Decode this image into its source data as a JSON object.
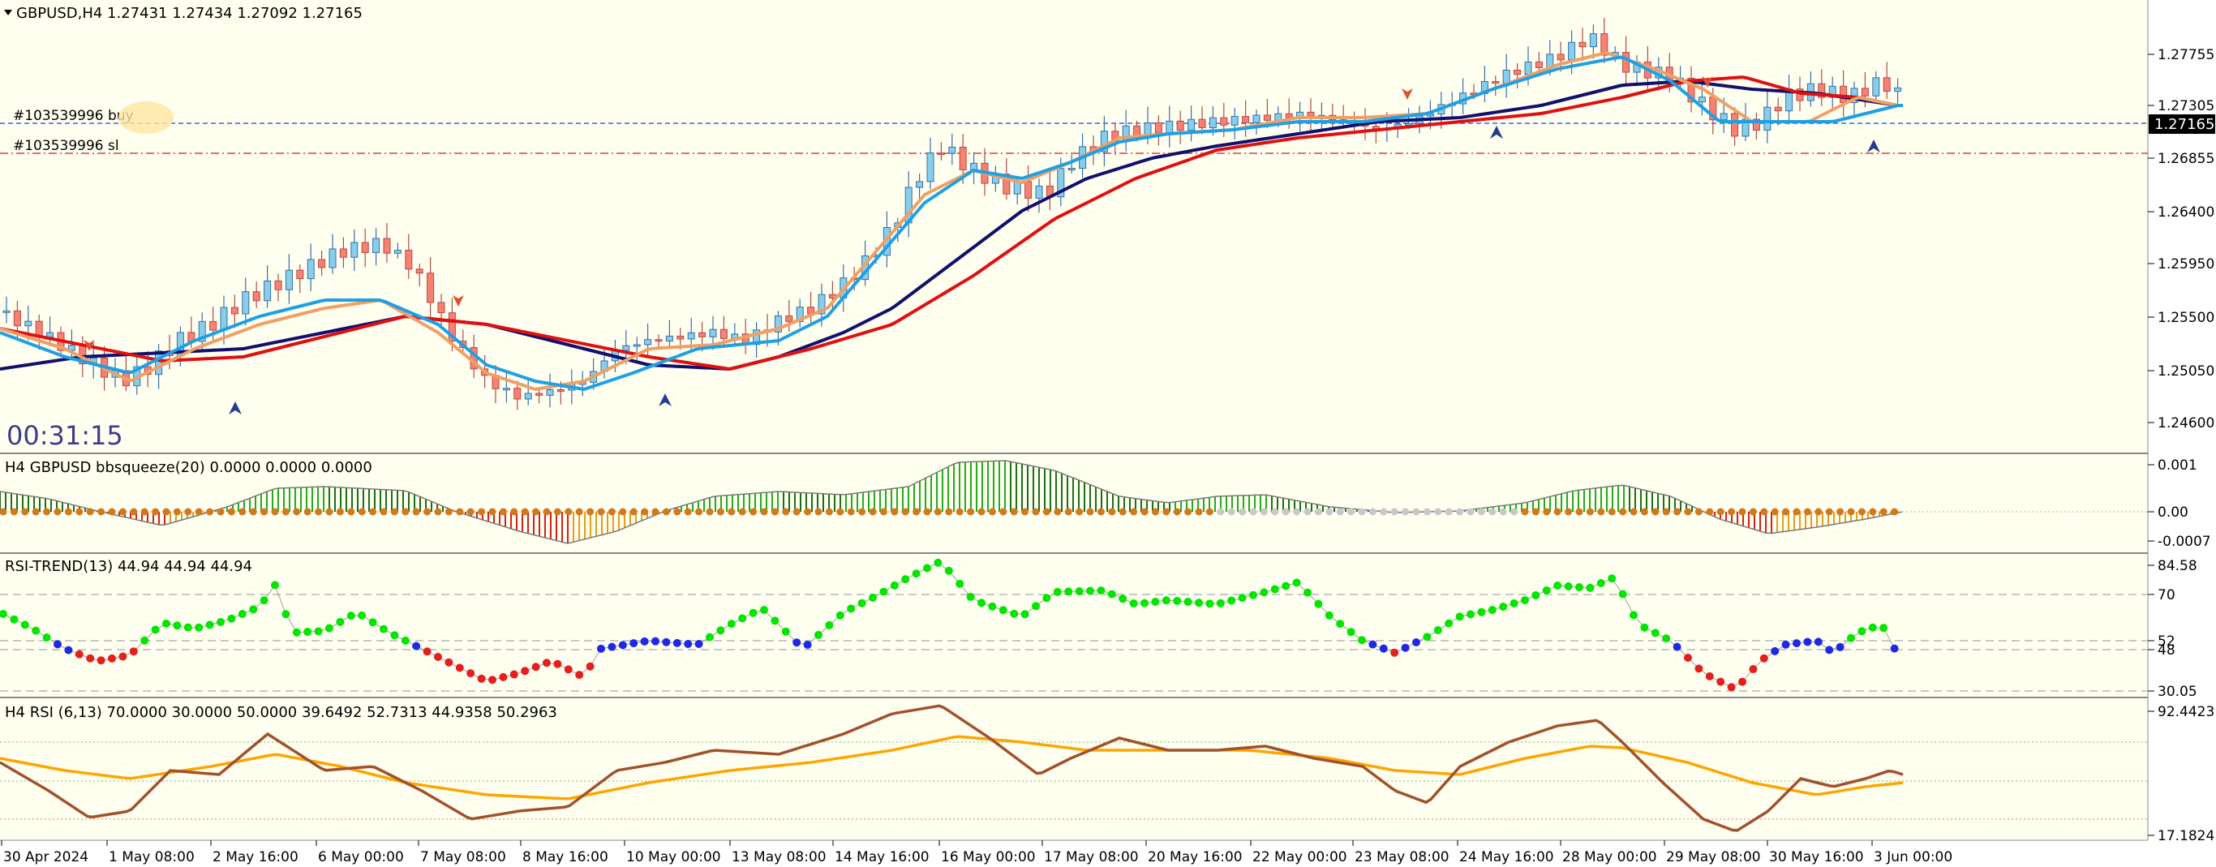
{
  "main": {
    "title": "GBPUSD,H4  1.27431 1.27434 1.27092 1.27165",
    "countdown": "00:31:15",
    "order_buy_label": "#103539996 buy",
    "order_sl_label": "#103539996 sl",
    "price_ticks": [
      "1.27755",
      "1.27305",
      "1.26855",
      "1.26400",
      "1.25950",
      "1.25500",
      "1.25050",
      "1.24600"
    ],
    "current_price": "1.27165"
  },
  "bbsqueeze": {
    "title": "H4 GBPUSD bbsqueeze(20) 0.0000 0.0000 0.0000",
    "ticks": [
      "0.001",
      "0.00",
      "-0.0007"
    ]
  },
  "rsi_trend": {
    "title": "RSI-TREND(13) 44.94 44.94 44.94",
    "ticks": [
      "84.58",
      "70",
      "52",
      "48",
      "30.05"
    ]
  },
  "rsi": {
    "title": "H4 RSI  (6,13) 70.0000 30.0000 50.0000 39.6492 52.7313 44.9358 50.2963",
    "ticks": [
      "92.4423",
      "17.1824"
    ]
  },
  "time_axis": {
    "labels": [
      "30 Apr 2024",
      "1 May 08:00",
      "2 May 16:00",
      "6 May 00:00",
      "7 May 08:00",
      "8 May 16:00",
      "10 May 00:00",
      "13 May 08:00",
      "14 May 16:00",
      "16 May 00:00",
      "17 May 08:00",
      "20 May 16:00",
      "22 May 00:00",
      "23 May 08:00",
      "24 May 16:00",
      "28 May 00:00",
      "29 May 08:00",
      "30 May 16:00",
      "3 Jun 00:00"
    ]
  },
  "colors": {
    "background": "#fffff0",
    "bull_candle": "#87ceeb",
    "bear_candle": "#fa8072",
    "ma_fast": "#1ea0e6",
    "ma_fast2": "#f0a064",
    "ma_slow": "#e01010",
    "ma_slow2": "#10106e",
    "rsi_up": "#00e600",
    "rsi_down": "#e61e1e",
    "rsi_neutral": "#1e28e6",
    "rsi_line": "#a0522d",
    "rsi_signal": "#ffa500"
  }
}
